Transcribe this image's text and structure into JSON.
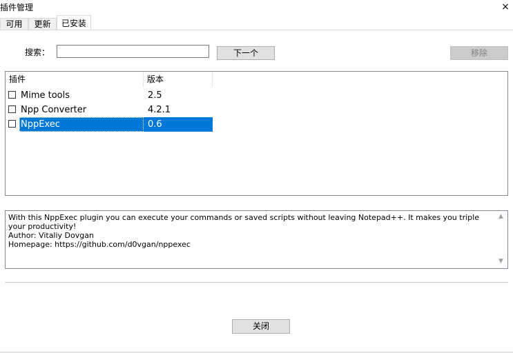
{
  "window": {
    "title": "插件管理",
    "close_glyph": "×"
  },
  "tabs": [
    {
      "label": "可用"
    },
    {
      "label": "更新"
    },
    {
      "label": "已安装"
    }
  ],
  "search": {
    "label": "搜索：",
    "value": "",
    "next_label": "下一个"
  },
  "remove_label": "移除",
  "list": {
    "columns": [
      "插件",
      "版本"
    ],
    "rows": [
      {
        "name": "Mime tools",
        "version": "2.5",
        "checked": false,
        "selected": false
      },
      {
        "name": "Npp Converter",
        "version": "4.2.1",
        "checked": false,
        "selected": false
      },
      {
        "name": "NppExec",
        "version": "0.6",
        "checked": false,
        "selected": true
      }
    ]
  },
  "description": {
    "line1": "With this NppExec plugin you can execute your commands or saved scripts without leaving Notepad++. It makes you triple your productivity!",
    "line2": "Author: Vitaliy Dovgan",
    "line3": "Homepage: https://github.com/d0vgan/nppexec"
  },
  "close_label": "关闭",
  "colors": {
    "selection": "#0078d7",
    "button_face": "#e1e1e1",
    "disabled_text": "#838383"
  }
}
